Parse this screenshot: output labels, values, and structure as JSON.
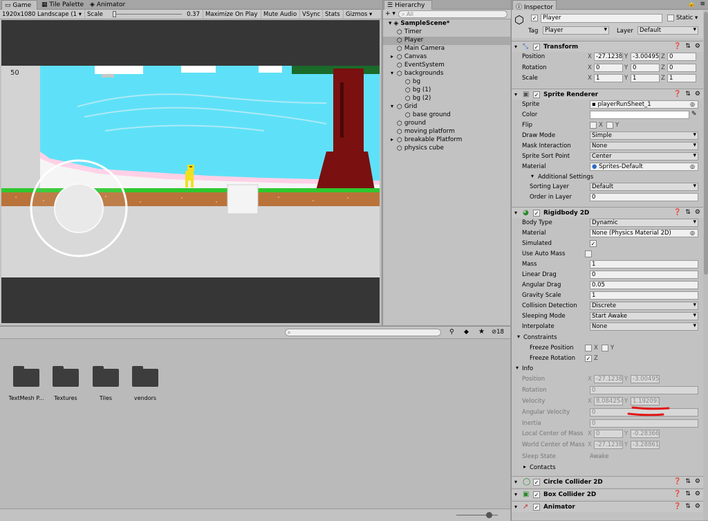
{
  "game": {
    "tabs": [
      "Game",
      "Tile Palette",
      "Animator"
    ],
    "toolbar": {
      "resolution": "1920x1080 Landscape (1",
      "scale_label": "Scale",
      "scale_value": "0.37",
      "maximize": "Maximize On Play",
      "mute": "Mute Audio",
      "vsync": "VSync",
      "stats": "Stats",
      "gizmos": "Gizmos"
    },
    "score": "50"
  },
  "hierarchy": {
    "title": "Hierarchy",
    "create": "Create",
    "search_placeholder": "All",
    "scene": "SampleScene*",
    "items": [
      {
        "label": "Timer",
        "depth": 1,
        "arrow": false
      },
      {
        "label": "Player",
        "depth": 1,
        "arrow": false,
        "selected": true
      },
      {
        "label": "Main Camera",
        "depth": 1,
        "arrow": false
      },
      {
        "label": "Canvas",
        "depth": 1,
        "arrow": "right"
      },
      {
        "label": "EventSystem",
        "depth": 1,
        "arrow": false
      },
      {
        "label": "backgrounds",
        "depth": 1,
        "arrow": "down"
      },
      {
        "label": "bg",
        "depth": 2,
        "arrow": false
      },
      {
        "label": "bg (1)",
        "depth": 2,
        "arrow": false
      },
      {
        "label": "bg (2)",
        "depth": 2,
        "arrow": false
      },
      {
        "label": "Grid",
        "depth": 1,
        "arrow": "down"
      },
      {
        "label": "base ground",
        "depth": 2,
        "arrow": false
      },
      {
        "label": "ground",
        "depth": 1,
        "arrow": false
      },
      {
        "label": "moving platform",
        "depth": 1,
        "arrow": false
      },
      {
        "label": "breakable Platform",
        "depth": 1,
        "arrow": "right"
      },
      {
        "label": "physics cube",
        "depth": 1,
        "arrow": false
      }
    ]
  },
  "project": {
    "folders": [
      "TextMesh P...",
      "Textures",
      "Tiles",
      "vendors"
    ],
    "count": "18"
  },
  "inspector": {
    "title": "Inspector",
    "object_name": "Player",
    "static_label": "Static",
    "tag_label": "Tag",
    "tag_value": "Player",
    "layer_label": "Layer",
    "layer_value": "Default",
    "transform": {
      "title": "Transform",
      "position": [
        "-27.1238",
        "-3.00495",
        "0"
      ],
      "rotation": [
        "0",
        "0",
        "0"
      ],
      "scale": [
        "1",
        "1",
        "1"
      ],
      "labels": [
        "Position",
        "Rotation",
        "Scale"
      ]
    },
    "sprite_renderer": {
      "title": "Sprite Renderer",
      "sprite_label": "Sprite",
      "sprite": "playerRunSheet_1",
      "color_label": "Color",
      "flip_label": "Flip",
      "flip_x": "X",
      "flip_y": "Y",
      "draw_mode_label": "Draw Mode",
      "draw_mode": "Simple",
      "mask_label": "Mask Interaction",
      "mask": "None",
      "sort_point_label": "Sprite Sort Point",
      "sort_point": "Center",
      "material_label": "Material",
      "material": "Sprites-Default",
      "additional": "Additional Settings",
      "sorting_layer_label": "Sorting Layer",
      "sorting_layer": "Default",
      "order_label": "Order in Layer",
      "order": "0"
    },
    "rigidbody": {
      "title": "Rigidbody 2D",
      "body_type_label": "Body Type",
      "body_type": "Dynamic",
      "material_label": "Material",
      "material": "None (Physics Material 2D)",
      "simulated_label": "Simulated",
      "auto_mass_label": "Use Auto Mass",
      "mass_label": "Mass",
      "mass": "1",
      "linear_drag_label": "Linear Drag",
      "linear_drag": "0",
      "angular_drag_label": "Angular Drag",
      "angular_drag": "0.05",
      "gravity_label": "Gravity Scale",
      "gravity": "1",
      "collision_label": "Collision Detection",
      "collision": "Discrete",
      "sleeping_label": "Sleeping Mode",
      "sleeping": "Start Awake",
      "interpolate_label": "Interpolate",
      "interpolate": "None",
      "constraints": "Constraints",
      "freeze_pos_label": "Freeze Position",
      "freeze_rot_label": "Freeze Rotation",
      "x": "X",
      "y": "Y",
      "z": "Z",
      "info": "Info",
      "info_position_label": "Position",
      "info_position": [
        "-27.1238",
        "-3.00495"
      ],
      "info_rotation_label": "Rotation",
      "info_rotation": "0",
      "velocity_label": "Velocity",
      "velocity": [
        "8.084254",
        "1.192093"
      ],
      "ang_vel_label": "Angular Velocity",
      "ang_vel": "0",
      "inertia_label": "Inertia",
      "inertia": "0",
      "local_com_label": "Local Center of Mass",
      "local_com": [
        "0",
        "-0.28366"
      ],
      "world_com_label": "World Center of Mass",
      "world_com": [
        "-27.1238",
        "-3.28861"
      ],
      "sleep_state_label": "Sleep State",
      "sleep_state": "Awake",
      "contacts": "Contacts"
    },
    "circle_collider": "Circle Collider 2D",
    "box_collider": "Box Collider 2D",
    "animator": "Animator"
  }
}
